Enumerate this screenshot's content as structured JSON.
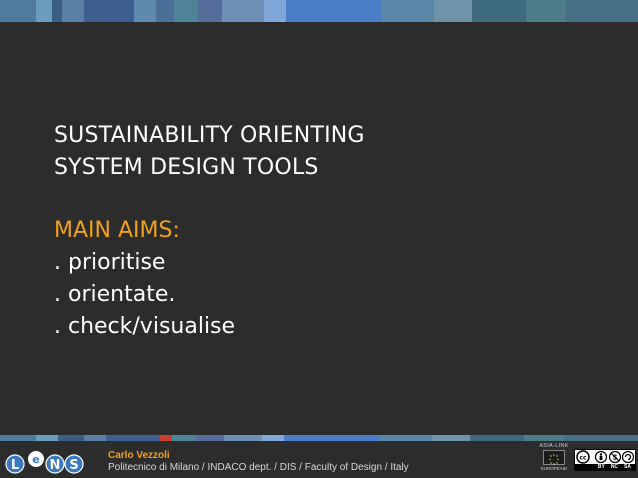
{
  "colors": {
    "background": "#2c2c2c",
    "title_text": "#ffffff",
    "accent_orange": "#f0a020",
    "footer_text": "#d8d8d8"
  },
  "slide": {
    "title_lines": [
      "SUSTAINABILITY ORIENTING",
      "SYSTEM DESIGN TOOLS"
    ],
    "aims_heading": "MAIN AIMS:",
    "bullets": [
      ". prioritise",
      ". orientate.",
      ". check/visualise"
    ]
  },
  "footer": {
    "logo_letters": [
      "L",
      "e",
      "N",
      "S"
    ],
    "author": "Carlo Vezzoli",
    "affiliation": "Politecnico di Milano / INDACO dept. / DIS / Faculty of Design / Italy",
    "asia_link": "ASIA-LINK",
    "eu_label": "EUROPEAID",
    "license_labels": [
      "BY",
      "NC",
      "SA"
    ]
  }
}
